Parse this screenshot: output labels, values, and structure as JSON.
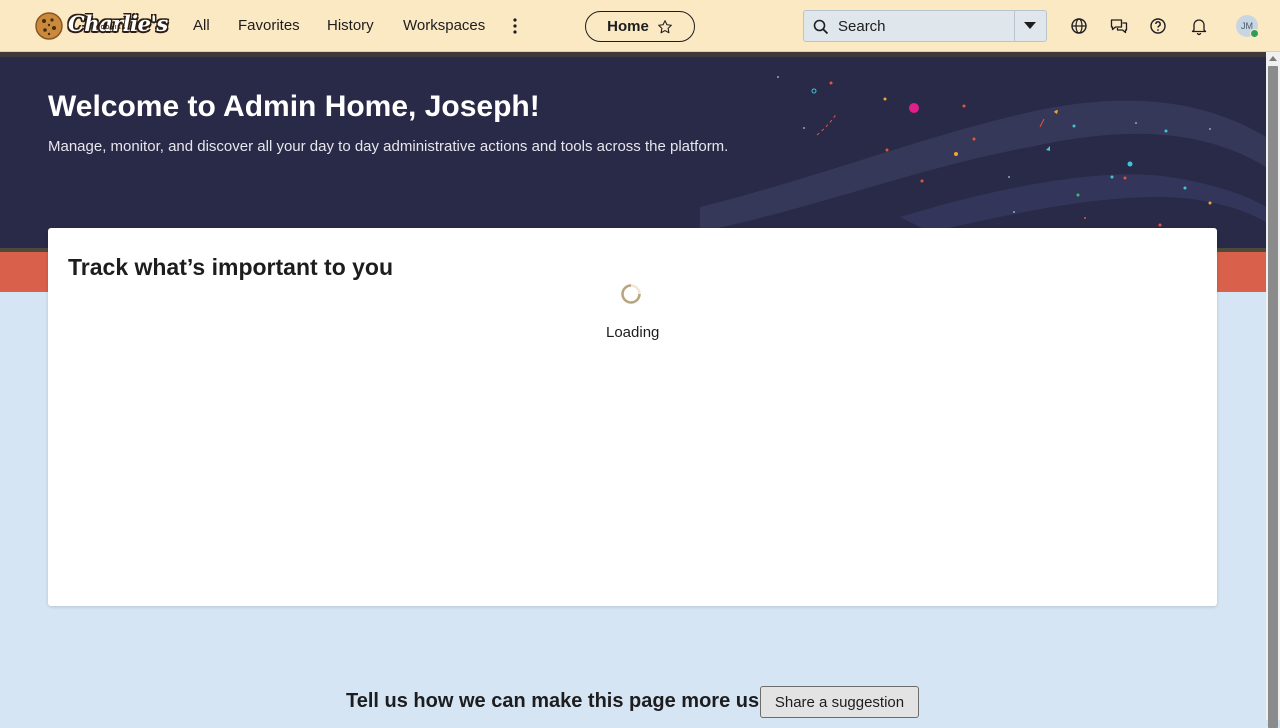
{
  "brand": {
    "name": "Charlie's",
    "sub": "COOKIES",
    "logo_icon": "cookie-icon"
  },
  "nav": {
    "links": [
      "All",
      "Favorites",
      "History",
      "Workspaces"
    ],
    "more_icon": "kebab-vertical-icon",
    "home_pill": {
      "label": "Home",
      "icon": "star-outline-icon"
    },
    "search": {
      "placeholder": "Search",
      "icon": "search-icon",
      "dropdown_icon": "caret-down-icon"
    },
    "right_icons": [
      "globe-icon",
      "chat-icon",
      "help-icon",
      "bell-icon"
    ],
    "avatar": {
      "initials": "JM",
      "status_color": "#2e9d5b"
    }
  },
  "hero": {
    "title": "Welcome to Admin Home, Joseph!",
    "subtitle": "Manage, monitor, and discover all your day to day administrative actions and tools across the platform."
  },
  "card": {
    "title": "Track what’s important to you",
    "loading_label": "Loading"
  },
  "feedback": {
    "prompt": "Tell us how we can make this page more useful",
    "button_label": "Share a suggestion"
  },
  "colors": {
    "topnav_bg": "#fbe9c4",
    "hero_bg": "#282a47",
    "coral_band": "#d9604a",
    "page_bg": "#d6e5f3"
  }
}
